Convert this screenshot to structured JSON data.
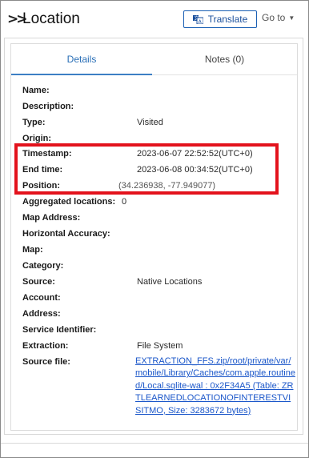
{
  "header": {
    "title": "Location",
    "translate_label": "Translate",
    "goto_label": "Go to"
  },
  "tabs": [
    {
      "label": "Details"
    },
    {
      "label": "Notes (0)"
    }
  ],
  "fields": [
    {
      "label": "Name:",
      "value": ""
    },
    {
      "label": "Description:",
      "value": ""
    },
    {
      "label": "Type:",
      "value": "Visited"
    },
    {
      "label": "Origin:",
      "value": ""
    },
    {
      "label": "Timestamp:",
      "value": "2023-06-07 22:52:52(UTC+0)"
    },
    {
      "label": "End time:",
      "value": "2023-06-08 00:34:52(UTC+0)"
    },
    {
      "label": "Position:",
      "value": "(34.236938,  -77.949077)"
    },
    {
      "label": "Aggregated locations:",
      "value": "0"
    },
    {
      "label": "Map Address:",
      "value": ""
    },
    {
      "label": "Horizontal Accuracy:",
      "value": ""
    },
    {
      "label": "Map:",
      "value": ""
    },
    {
      "label": "Category:",
      "value": ""
    },
    {
      "label": "Source:",
      "value": "Native Locations"
    },
    {
      "label": "Account:",
      "value": ""
    },
    {
      "label": "Address:",
      "value": ""
    },
    {
      "label": "Service Identifier:",
      "value": ""
    },
    {
      "label": "Extraction:",
      "value": "File System"
    },
    {
      "label": "Source file:",
      "value": ""
    }
  ],
  "source_file_link": "EXTRACTION_FFS.zip/root/private/var/mobile/Library/Caches/com.apple.routined/Local.sqlite-wal : 0x2F34A5 (Table: ZRTLEARNEDLOCATIONOFINTERESTVISITMO, Size: 3283672 bytes)",
  "colors": {
    "accent": "#2a6fb7",
    "highlight": "#e3121c",
    "link": "#1a56c9"
  }
}
